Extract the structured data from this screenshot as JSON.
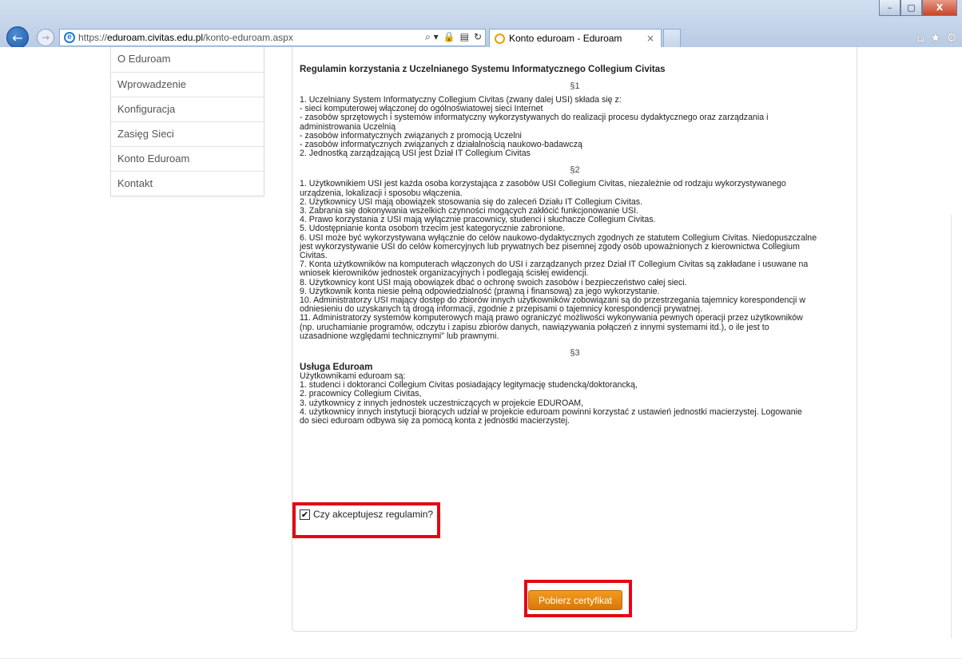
{
  "browser": {
    "url_scheme": "https://",
    "url_domain": "eduroam.civitas.edu.pl",
    "url_path": "/konto-eduroam.aspx",
    "tab_title": "Konto eduroam - Eduroam",
    "tab_close": "×",
    "window_controls": [
      "–",
      "▢",
      "X"
    ],
    "address_tools": [
      "⌕ ▾",
      "🔒",
      "▤",
      "↻"
    ],
    "right_icons": [
      "⌂",
      "★",
      "⚙"
    ]
  },
  "sidebar": {
    "items": [
      {
        "label": "O Eduroam"
      },
      {
        "label": "Wprowadzenie"
      },
      {
        "label": "Konfiguracja"
      },
      {
        "label": "Zasięg Sieci"
      },
      {
        "label": "Konto Eduroam"
      },
      {
        "label": "Kontakt"
      }
    ]
  },
  "rules": {
    "title": "Regulamin korzystania z Uczelnianego Systemu Informatycznego Collegium Civitas",
    "s1": {
      "mark": "§1",
      "lines": [
        "1. Uczelniany System Informatyczny Collegium Civitas (zwany dalej USI) składa się z:",
        "- sieci komputerowej włączonej do ogólnoświatowej sieci Internet",
        "- zasobów sprzętowych i systemów informatyczny wykorzystywanych do realizacji procesu dydaktycznego oraz zarządzania i",
        "administrowania Uczelnią",
        "- zasobów informatycznych związanych z promocją Uczelni",
        "- zasobów informatycznych związanych z działalnością naukowo-badawczą",
        "2. Jednostką zarządzającą USI jest Dział IT Collegium Civitas"
      ]
    },
    "s2": {
      "mark": "§2",
      "lines": [
        "1. Użytkownikiem USI jest każda osoba korzystająca z zasobów USI Collegium Civitas, niezależnie od rodzaju wykorzystywanego",
        "urządzenia, lokalizacji i sposobu włączenia.",
        "2. Użytkownicy USI mają obowiązek stosowania się do zaleceń Działu IT Collegium Civitas.",
        "3. Zabrania się dokonywania wszelkich czynności mogących zakłócić funkcjonowanie USI.",
        "4. Prawo korzystania z USI mają wyłącznie pracownicy, studenci i słuchacze Collegium Civitas.",
        "5. Udostępnianie konta osobom trzecim jest kategorycznie zabronione.",
        "6. USI może być wykorzystywana wyłącznie do celów naukowo-dydaktycznych zgodnych ze statutem Collegium Civitas. Niedopuszczalne",
        "jest wykorzystywanie USI do celów komercyjnych lub prywatnych bez pisemnej zgody osób upoważnionych z kierownictwa Collegium",
        "Civitas.",
        "7. Konta użytkowników na komputerach włączonych do USI i zarządzanych przez Dział IT Collegium Civitas są zakładane i usuwane na",
        "wniosek kierowników jednostek organizacyjnych i podlegają ścisłej ewidencji.",
        "8. Użytkownicy kont USI mają obowiązek dbać o ochronę swoich zasobów i bezpieczeństwo całej sieci.",
        "9. Użytkownik konta niesie pełną odpowiedzialność (prawną i finansową) za jego wykorzystanie.",
        "10. Administratorzy USI mający dostęp do zbiorów innych użytkowników zobowiązani są do przestrzegania tajemnicy korespondencji w",
        "odniesieniu do uzyskanych tą drogą informacji, zgodnie z przepisami o tajemnicy korespondencji prywatnej.",
        "11. Administratorzy systemów komputerowych mają prawo ograniczyć możliwości wykonywania pewnych operacji przez użytkowników",
        "(np. uruchamianie programów, odczytu i zapisu zbiorów danych, nawiązywania połączeń z innymi systemami itd.), o ile jest to",
        "uzasadnione względami technicznymi\" lub prawnymi."
      ]
    },
    "s3": {
      "mark": "§3",
      "heading": "Usługa Eduroam",
      "lines": [
        "Użytkownikami eduroam są:",
        "1. studenci i doktoranci Collegium Civitas posiadający legitymację studencką/doktorancką,",
        "2. pracownicy Collegium Civitas,",
        "3. użytkownicy z innych jednostek uczestniczących w projekcie EDUROAM,",
        "4. użytkownicy innych instytucji biorących udział w projekcie eduroam powinni korzystać z ustawień jednostki macierzystej. Logowanie",
        "do sieci eduroam odbywa się za pomocą konta z jednostki macierzystej."
      ]
    }
  },
  "accept": {
    "label": "Czy akceptujesz regulamin?",
    "checked": true,
    "check_glyph": "✔"
  },
  "download_button": {
    "label": "Pobierz certyfikat"
  },
  "colors": {
    "highlight": "#e30613",
    "button": "#e8850f",
    "chrome": "#c3d4ea"
  }
}
